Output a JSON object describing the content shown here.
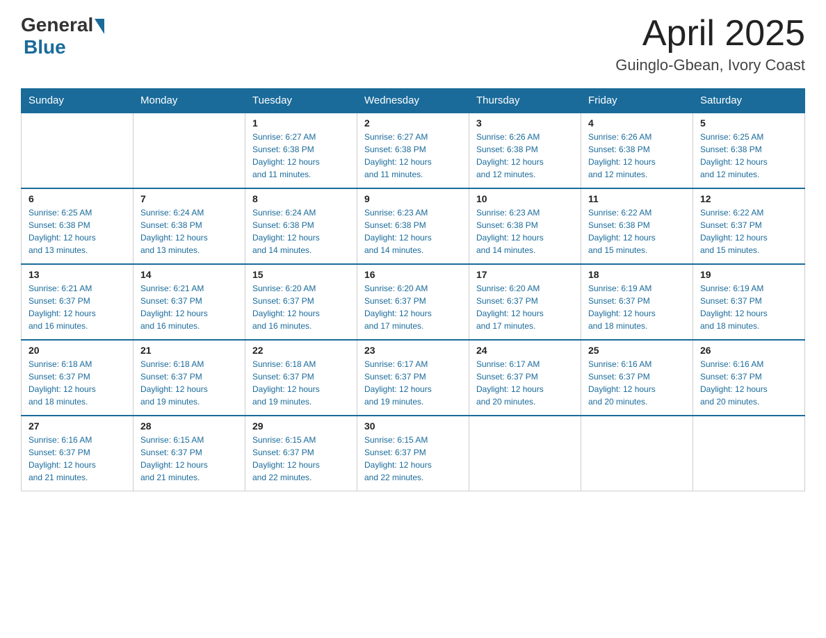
{
  "logo": {
    "general": "General",
    "blue": "Blue"
  },
  "title": {
    "month_year": "April 2025",
    "location": "Guinglo-Gbean, Ivory Coast"
  },
  "days_of_week": [
    "Sunday",
    "Monday",
    "Tuesday",
    "Wednesday",
    "Thursday",
    "Friday",
    "Saturday"
  ],
  "weeks": [
    [
      {
        "day": "",
        "info": ""
      },
      {
        "day": "",
        "info": ""
      },
      {
        "day": "1",
        "info": "Sunrise: 6:27 AM\nSunset: 6:38 PM\nDaylight: 12 hours\nand 11 minutes."
      },
      {
        "day": "2",
        "info": "Sunrise: 6:27 AM\nSunset: 6:38 PM\nDaylight: 12 hours\nand 11 minutes."
      },
      {
        "day": "3",
        "info": "Sunrise: 6:26 AM\nSunset: 6:38 PM\nDaylight: 12 hours\nand 12 minutes."
      },
      {
        "day": "4",
        "info": "Sunrise: 6:26 AM\nSunset: 6:38 PM\nDaylight: 12 hours\nand 12 minutes."
      },
      {
        "day": "5",
        "info": "Sunrise: 6:25 AM\nSunset: 6:38 PM\nDaylight: 12 hours\nand 12 minutes."
      }
    ],
    [
      {
        "day": "6",
        "info": "Sunrise: 6:25 AM\nSunset: 6:38 PM\nDaylight: 12 hours\nand 13 minutes."
      },
      {
        "day": "7",
        "info": "Sunrise: 6:24 AM\nSunset: 6:38 PM\nDaylight: 12 hours\nand 13 minutes."
      },
      {
        "day": "8",
        "info": "Sunrise: 6:24 AM\nSunset: 6:38 PM\nDaylight: 12 hours\nand 14 minutes."
      },
      {
        "day": "9",
        "info": "Sunrise: 6:23 AM\nSunset: 6:38 PM\nDaylight: 12 hours\nand 14 minutes."
      },
      {
        "day": "10",
        "info": "Sunrise: 6:23 AM\nSunset: 6:38 PM\nDaylight: 12 hours\nand 14 minutes."
      },
      {
        "day": "11",
        "info": "Sunrise: 6:22 AM\nSunset: 6:38 PM\nDaylight: 12 hours\nand 15 minutes."
      },
      {
        "day": "12",
        "info": "Sunrise: 6:22 AM\nSunset: 6:37 PM\nDaylight: 12 hours\nand 15 minutes."
      }
    ],
    [
      {
        "day": "13",
        "info": "Sunrise: 6:21 AM\nSunset: 6:37 PM\nDaylight: 12 hours\nand 16 minutes."
      },
      {
        "day": "14",
        "info": "Sunrise: 6:21 AM\nSunset: 6:37 PM\nDaylight: 12 hours\nand 16 minutes."
      },
      {
        "day": "15",
        "info": "Sunrise: 6:20 AM\nSunset: 6:37 PM\nDaylight: 12 hours\nand 16 minutes."
      },
      {
        "day": "16",
        "info": "Sunrise: 6:20 AM\nSunset: 6:37 PM\nDaylight: 12 hours\nand 17 minutes."
      },
      {
        "day": "17",
        "info": "Sunrise: 6:20 AM\nSunset: 6:37 PM\nDaylight: 12 hours\nand 17 minutes."
      },
      {
        "day": "18",
        "info": "Sunrise: 6:19 AM\nSunset: 6:37 PM\nDaylight: 12 hours\nand 18 minutes."
      },
      {
        "day": "19",
        "info": "Sunrise: 6:19 AM\nSunset: 6:37 PM\nDaylight: 12 hours\nand 18 minutes."
      }
    ],
    [
      {
        "day": "20",
        "info": "Sunrise: 6:18 AM\nSunset: 6:37 PM\nDaylight: 12 hours\nand 18 minutes."
      },
      {
        "day": "21",
        "info": "Sunrise: 6:18 AM\nSunset: 6:37 PM\nDaylight: 12 hours\nand 19 minutes."
      },
      {
        "day": "22",
        "info": "Sunrise: 6:18 AM\nSunset: 6:37 PM\nDaylight: 12 hours\nand 19 minutes."
      },
      {
        "day": "23",
        "info": "Sunrise: 6:17 AM\nSunset: 6:37 PM\nDaylight: 12 hours\nand 19 minutes."
      },
      {
        "day": "24",
        "info": "Sunrise: 6:17 AM\nSunset: 6:37 PM\nDaylight: 12 hours\nand 20 minutes."
      },
      {
        "day": "25",
        "info": "Sunrise: 6:16 AM\nSunset: 6:37 PM\nDaylight: 12 hours\nand 20 minutes."
      },
      {
        "day": "26",
        "info": "Sunrise: 6:16 AM\nSunset: 6:37 PM\nDaylight: 12 hours\nand 20 minutes."
      }
    ],
    [
      {
        "day": "27",
        "info": "Sunrise: 6:16 AM\nSunset: 6:37 PM\nDaylight: 12 hours\nand 21 minutes."
      },
      {
        "day": "28",
        "info": "Sunrise: 6:15 AM\nSunset: 6:37 PM\nDaylight: 12 hours\nand 21 minutes."
      },
      {
        "day": "29",
        "info": "Sunrise: 6:15 AM\nSunset: 6:37 PM\nDaylight: 12 hours\nand 22 minutes."
      },
      {
        "day": "30",
        "info": "Sunrise: 6:15 AM\nSunset: 6:37 PM\nDaylight: 12 hours\nand 22 minutes."
      },
      {
        "day": "",
        "info": ""
      },
      {
        "day": "",
        "info": ""
      },
      {
        "day": "",
        "info": ""
      }
    ]
  ]
}
